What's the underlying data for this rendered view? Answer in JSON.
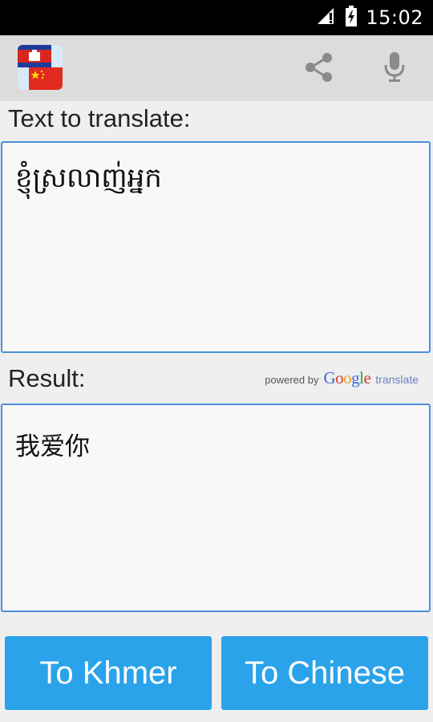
{
  "status_bar": {
    "time": "15:02",
    "icons": [
      "signal-icon",
      "battery-charging-icon"
    ]
  },
  "app_bar": {
    "app_icon": "cambodia-china-flag-icon",
    "actions": [
      "share-icon",
      "microphone-icon"
    ]
  },
  "input": {
    "label": "Text to translate:",
    "value": "ខ្ញុំស្រលាញ់អ្នក"
  },
  "result": {
    "label": "Result:",
    "value": "我爱你",
    "powered_by": {
      "prefix": "powered by",
      "brand": "Google",
      "suffix": "translate"
    }
  },
  "buttons": {
    "to_khmer": "To Khmer",
    "to_chinese": "To Chinese"
  },
  "colors": {
    "accent": "#2aa3ea",
    "border": "#4a90d9",
    "appbar": "#dcdcdc",
    "background": "#efefef"
  }
}
